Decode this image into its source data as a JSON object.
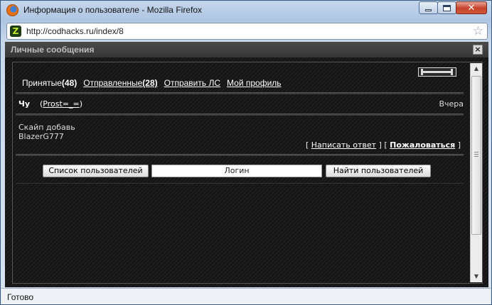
{
  "window": {
    "title": "Информация о пользователе - Mozilla Firefox",
    "url": "http://codhacks.ru/index/8",
    "status": "Готово"
  },
  "dialog": {
    "title": "Личные сообщения",
    "close_glyph": "×"
  },
  "tabs": [
    {
      "label": "Принятые",
      "count": "(48)"
    },
    {
      "label": "Отправленные",
      "count": "(28)"
    },
    {
      "label": "Отправить ЛС"
    },
    {
      "label": "Мой профиль"
    }
  ],
  "message": {
    "sender": "Чу",
    "from_prefix": "(",
    "from_user": "Prost=_=",
    "from_suffix": ")",
    "date": "Вчера",
    "body_line1": "Скайп добавь",
    "body_line2": "BlazerG777",
    "actions": {
      "open1": "[",
      "reply": "Написать ответ",
      "mid": "] [",
      "complain": "Пожаловаться",
      "close": "]"
    }
  },
  "search": {
    "users_button": "Список пользователей",
    "login_value": "Логин",
    "find_button": "Найти пользователей"
  },
  "icons": {
    "browser": "firefox-icon",
    "site": "site-favicon",
    "bookmark": "star-icon"
  },
  "colors": {
    "page_bg": "#1b1b1b",
    "header_bg": "#404040",
    "link": "#ffffff",
    "close_button": "#c5412a"
  }
}
